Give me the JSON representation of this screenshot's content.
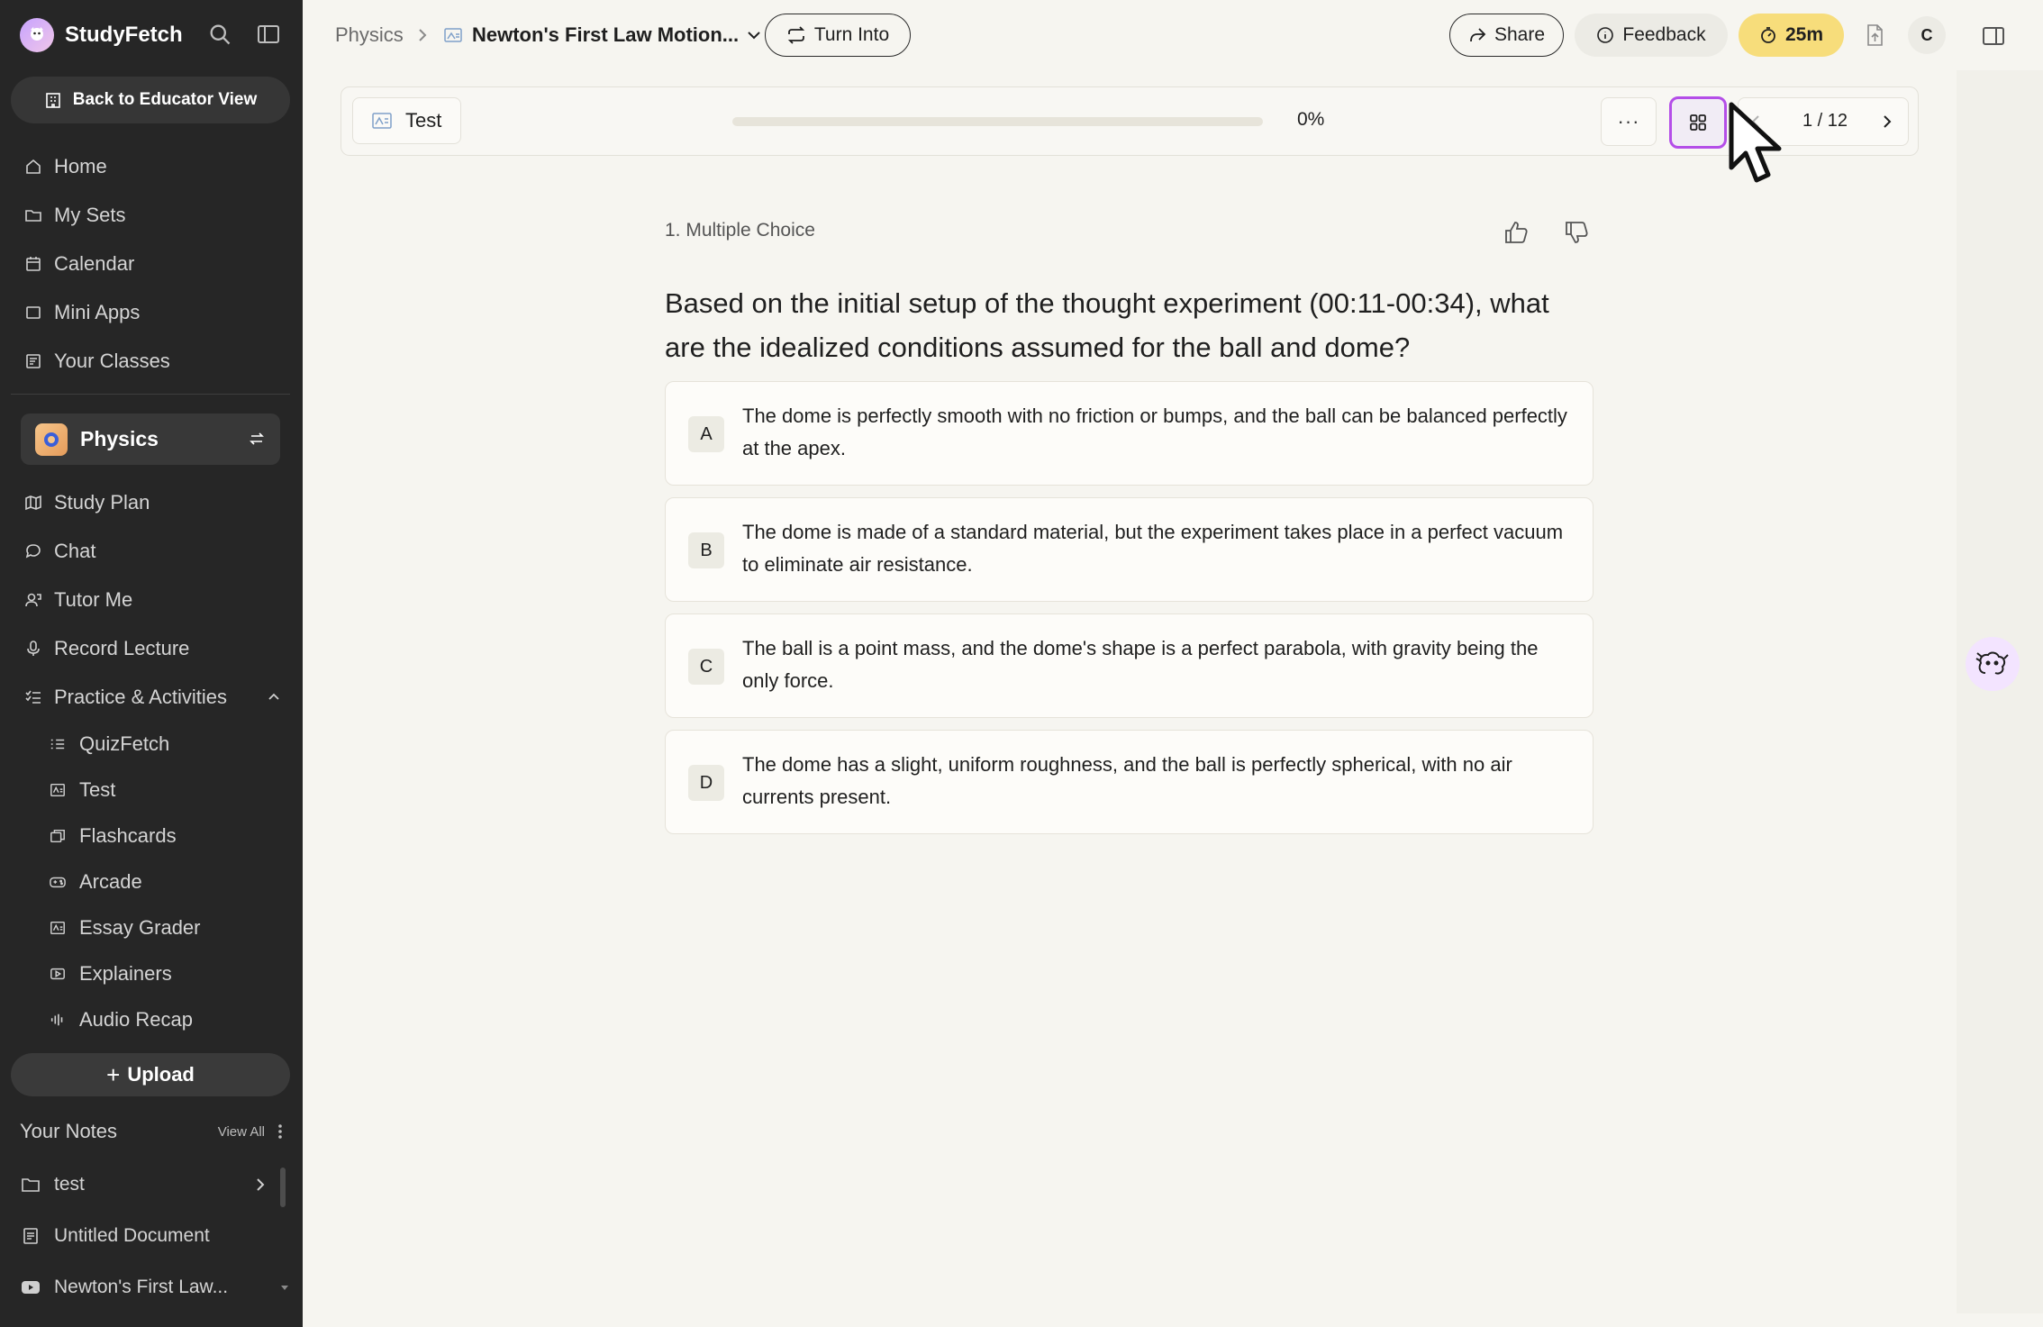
{
  "app": {
    "brand_name": "StudyFetch"
  },
  "sidebar": {
    "educator_button": "Back to Educator View",
    "nav": [
      {
        "label": "Home",
        "icon": "home-icon"
      },
      {
        "label": "My Sets",
        "icon": "folder-icon"
      },
      {
        "label": "Calendar",
        "icon": "calendar-icon"
      },
      {
        "label": "Mini Apps",
        "icon": "apps-icon"
      },
      {
        "label": "Your Classes",
        "icon": "classes-icon"
      }
    ],
    "class_name": "Physics",
    "class_nav": [
      {
        "label": "Study Plan",
        "icon": "map-icon"
      },
      {
        "label": "Chat",
        "icon": "chat-icon"
      },
      {
        "label": "Tutor Me",
        "icon": "tutor-icon"
      },
      {
        "label": "Record Lecture",
        "icon": "microphone-icon"
      },
      {
        "label": "Practice & Activities",
        "icon": "checklist-icon"
      }
    ],
    "activities": [
      {
        "label": "QuizFetch",
        "icon": "checklist-icon"
      },
      {
        "label": "Test",
        "icon": "test-icon"
      },
      {
        "label": "Flashcards",
        "icon": "flashcards-icon"
      },
      {
        "label": "Arcade",
        "icon": "gamepad-icon"
      },
      {
        "label": "Essay Grader",
        "icon": "essay-icon"
      },
      {
        "label": "Explainers",
        "icon": "video-icon"
      },
      {
        "label": "Audio Recap",
        "icon": "audio-icon"
      }
    ],
    "upload_label": "Upload",
    "notes_title": "Your Notes",
    "notes_view_all": "View All",
    "notes": [
      {
        "label": "test",
        "icon": "folder-icon"
      },
      {
        "label": "Untitled Document",
        "icon": "document-icon"
      },
      {
        "label": "Newton's First Law...",
        "icon": "youtube-icon"
      }
    ]
  },
  "header": {
    "breadcrumb_root": "Physics",
    "breadcrumb_doc": "Newton's First Law Motion...",
    "turn_into": "Turn Into",
    "share": "Share",
    "feedback": "Feedback",
    "timer": "25m",
    "user_initial": "C"
  },
  "toolbar": {
    "tab_label": "Test",
    "progress_percent": 0,
    "progress_label": "0%",
    "more_label": "···",
    "pager_label": "1 / 12"
  },
  "question": {
    "type_label": "1. Multiple Choice",
    "text": "Based on the initial setup of the thought experiment (00:11-00:34), what are the idealized conditions assumed for the ball and dome?",
    "options": [
      {
        "letter": "A",
        "text": "The dome is perfectly smooth with no friction or bumps, and the ball can be balanced perfectly at the apex."
      },
      {
        "letter": "B",
        "text": "The dome is made of a standard material, but the experiment takes place in a perfect vacuum to eliminate air resistance."
      },
      {
        "letter": "C",
        "text": "The ball is a point mass, and the dome's shape is a perfect parabola, with gravity being the only force."
      },
      {
        "letter": "D",
        "text": "The dome has a slight, uniform roughness, and the ball is perfectly spherical, with no air currents present."
      }
    ]
  },
  "colors": {
    "sidebar_bg": "#262626",
    "page_bg": "#f6f5f0",
    "accent_purple": "#b44ee8",
    "timer_yellow": "#f7dd7b"
  }
}
